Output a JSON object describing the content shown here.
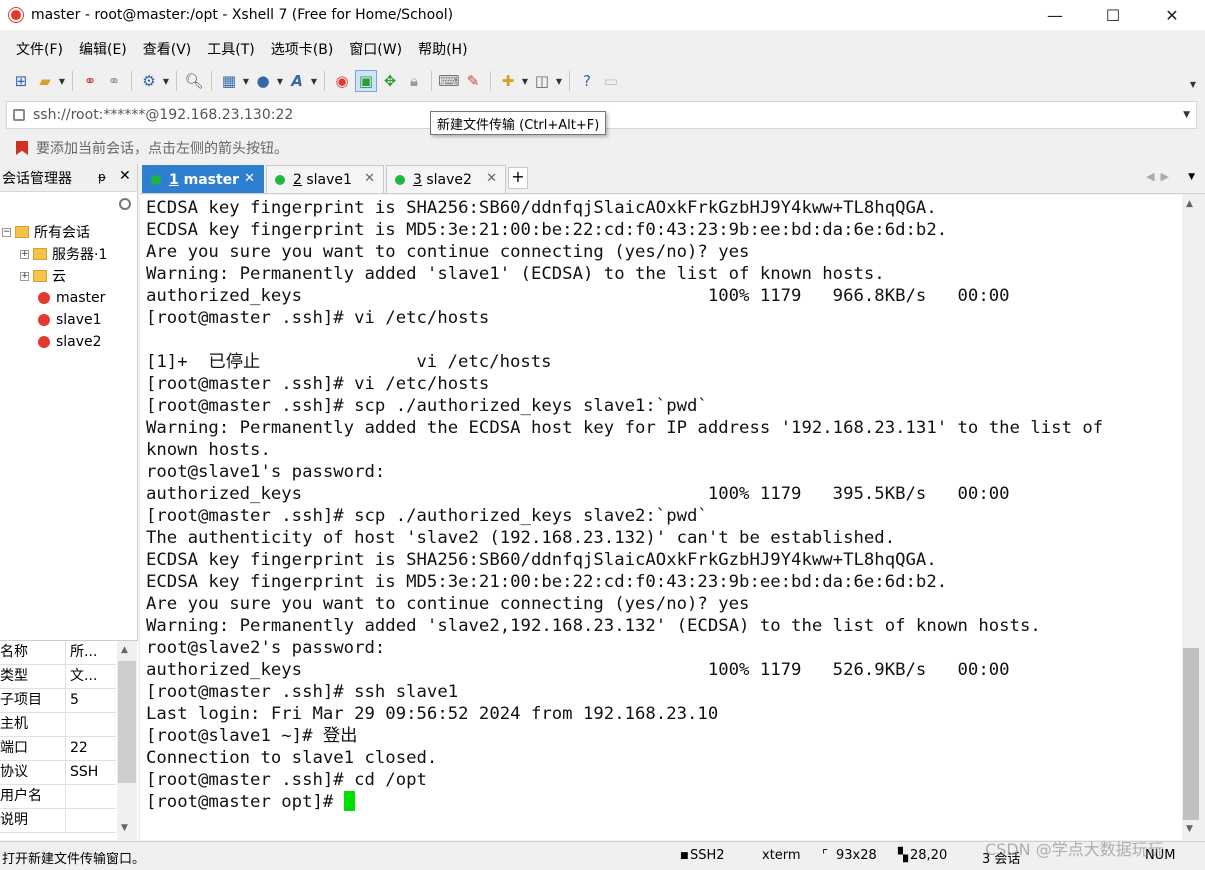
{
  "window": {
    "title": "master - root@master:/opt - Xshell 7 (Free for Home/School)",
    "minimize": "—",
    "maximize": "☐",
    "close": "✕"
  },
  "menu": [
    "文件(F)",
    "编辑(E)",
    "查看(V)",
    "工具(T)",
    "选项卡(B)",
    "窗口(W)",
    "帮助(H)"
  ],
  "address": {
    "value": "ssh://root:******@192.168.23.130:22"
  },
  "tooltip": "新建文件传输 (Ctrl+Alt+F)",
  "hint": "要添加当前会话，点击左侧的箭头按钮。",
  "session_manager": {
    "title": "会话管理器",
    "pin": "ᵽ",
    "close": "✕",
    "tree": {
      "root": "所有会话",
      "folders": [
        "服务器·1",
        "云"
      ],
      "sessions": [
        "master",
        "slave1",
        "slave2"
      ]
    }
  },
  "properties": [
    {
      "key": "名称",
      "value": "所..."
    },
    {
      "key": "类型",
      "value": "文..."
    },
    {
      "key": "子项目",
      "value": "5"
    },
    {
      "key": "主机",
      "value": ""
    },
    {
      "key": "端口",
      "value": "22"
    },
    {
      "key": "协议",
      "value": "SSH"
    },
    {
      "key": "用户名",
      "value": ""
    },
    {
      "key": "说明",
      "value": ""
    }
  ],
  "tabs": [
    {
      "num": "1",
      "label": "master"
    },
    {
      "num": "2",
      "label": "slave1"
    },
    {
      "num": "3",
      "label": "slave2"
    }
  ],
  "terminal": {
    "lines": [
      "ECDSA key fingerprint is SHA256:SB60/ddnfqjSlaicAOxkFrkGzbHJ9Y4kww+TL8hqQGA.",
      "ECDSA key fingerprint is MD5:3e:21:00:be:22:cd:f0:43:23:9b:ee:bd:da:6e:6d:b2.",
      "Are you sure you want to continue connecting (yes/no)? yes",
      "Warning: Permanently added 'slave1' (ECDSA) to the list of known hosts.",
      "authorized_keys                                       100% 1179   966.8KB/s   00:00",
      "[root@master .ssh]# vi /etc/hosts",
      "",
      "[1]+  已停止               vi /etc/hosts",
      "[root@master .ssh]# vi /etc/hosts",
      "[root@master .ssh]# scp ./authorized_keys slave1:`pwd`",
      "Warning: Permanently added the ECDSA host key for IP address '192.168.23.131' to the list of",
      "known hosts.",
      "root@slave1's password:",
      "authorized_keys                                       100% 1179   395.5KB/s   00:00",
      "[root@master .ssh]# scp ./authorized_keys slave2:`pwd`",
      "The authenticity of host 'slave2 (192.168.23.132)' can't be established.",
      "ECDSA key fingerprint is SHA256:SB60/ddnfqjSlaicAOxkFrkGzbHJ9Y4kww+TL8hqQGA.",
      "ECDSA key fingerprint is MD5:3e:21:00:be:22:cd:f0:43:23:9b:ee:bd:da:6e:6d:b2.",
      "Are you sure you want to continue connecting (yes/no)? yes",
      "Warning: Permanently added 'slave2,192.168.23.132' (ECDSA) to the list of known hosts.",
      "root@slave2's password:",
      "authorized_keys                                       100% 1179   526.9KB/s   00:00",
      "[root@master .ssh]# ssh slave1",
      "Last login: Fri Mar 29 09:56:52 2024 from 192.168.23.10",
      "[root@slave1 ~]# 登出",
      "Connection to slave1 closed.",
      "[root@master .ssh]# cd /opt"
    ],
    "prompt": "[root@master opt]# "
  },
  "status": {
    "message": "打开新建文件传输窗口。",
    "protocol": "SSH2",
    "term": "xterm",
    "size": "93x28",
    "pos": "28,20",
    "sessions": "3 会话",
    "num": "NUM"
  },
  "watermark": "CSDN @学点大数据玩玩"
}
